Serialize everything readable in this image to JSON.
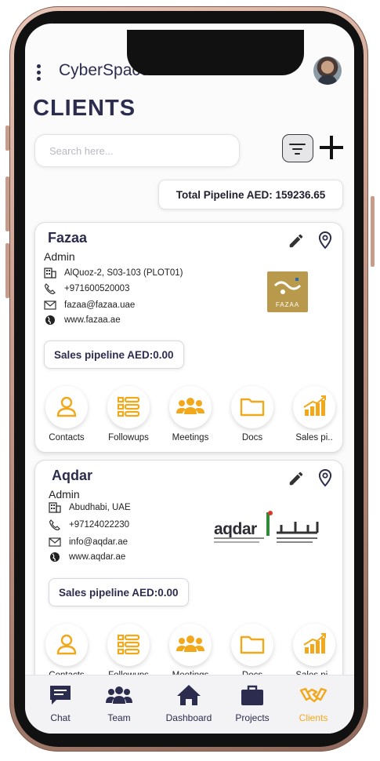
{
  "app": {
    "title": "CyberSpace"
  },
  "page": {
    "title": "CLIENTS"
  },
  "search": {
    "placeholder": "Search here..."
  },
  "pipeline_total": {
    "label": "Total Pipeline AED: 159236.65"
  },
  "colors": {
    "accent": "#f1a81a",
    "primary_text": "#2c2c4f",
    "phone_frame": "#c79b8b"
  },
  "clients": [
    {
      "name": "Fazaa",
      "role": "Admin",
      "address": "AlQuoz-2, S03-103 (PLOT01)",
      "phone": "+971600520003",
      "email": "fazaa@fazaa.uae",
      "website": "www.fazaa.ae",
      "logo_text": "FAZAA",
      "pipeline": "Sales pipeline AED:0.00",
      "actions": [
        "Contacts",
        "Followups",
        "Meetings",
        "Docs",
        "Sales pi.."
      ]
    },
    {
      "name": "Aqdar",
      "role": "Admin",
      "address": "Abudhabi, UAE",
      "phone": "+97124022230",
      "email": "info@aqdar.ae",
      "website": "www.aqdar.ae",
      "logo_text": "aqdar",
      "pipeline": "Sales pipeline AED:0.00",
      "actions": [
        "Contacts",
        "Followups",
        "Meetings",
        "Docs",
        "Sales pi.."
      ]
    }
  ],
  "nav": [
    {
      "label": "Chat",
      "icon": "chat-icon"
    },
    {
      "label": "Team",
      "icon": "team-icon"
    },
    {
      "label": "Dashboard",
      "icon": "home-icon"
    },
    {
      "label": "Projects",
      "icon": "briefcase-icon"
    },
    {
      "label": "Clients",
      "icon": "handshake-icon",
      "active": true
    }
  ]
}
